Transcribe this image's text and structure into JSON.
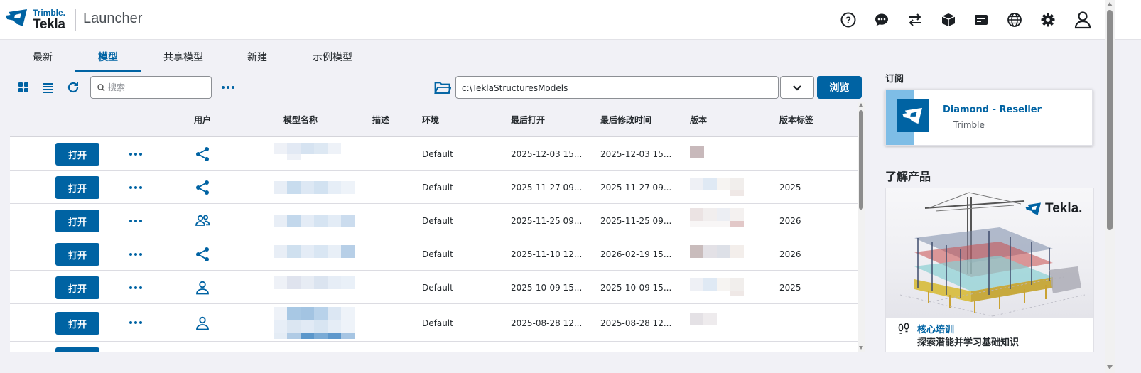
{
  "header": {
    "brand_top": "Trimble.",
    "brand_bottom": "Tekla",
    "app_title": "Launcher",
    "icons": [
      "help-icon",
      "chat-icon",
      "switch-icon",
      "package-icon",
      "license-icon",
      "language-icon",
      "settings-icon",
      "account-icon"
    ]
  },
  "tabs": [
    {
      "label": "最新"
    },
    {
      "label": "模型",
      "active": true
    },
    {
      "label": "共享模型"
    },
    {
      "label": "新建"
    },
    {
      "label": "示例模型"
    }
  ],
  "toolbar": {
    "search_placeholder": "搜索",
    "path_value": "c:\\TeklaStructuresModels",
    "browse_label": "浏览"
  },
  "table": {
    "columns": [
      "用户",
      "模型名称",
      "描述",
      "环境",
      "最后打开",
      "最后修改时间",
      "版本",
      "版本标签"
    ],
    "open_label": "打开",
    "rows": [
      {
        "user_icon": "share-icon",
        "environment": "Default",
        "last_opened": "2025-12-03 15...",
        "last_modified": "2025-12-03 15...",
        "version_tag": ""
      },
      {
        "user_icon": "share-icon",
        "environment": "Default",
        "last_opened": "2025-11-27 09...",
        "last_modified": "2025-11-27 09...",
        "version_tag": "2025"
      },
      {
        "user_icon": "group-icon",
        "environment": "Default",
        "last_opened": "2025-11-25 09...",
        "last_modified": "2025-11-25 09...",
        "version_tag": "2026"
      },
      {
        "user_icon": "share-icon",
        "environment": "Default",
        "last_opened": "2025-11-10 12...",
        "last_modified": "2026-02-19 15...",
        "version_tag": "2026"
      },
      {
        "user_icon": "person-icon",
        "environment": "Default",
        "last_opened": "2025-10-09 15...",
        "last_modified": "2025-10-09 15...",
        "version_tag": "2025"
      },
      {
        "user_icon": "person-icon",
        "environment": "Default",
        "last_opened": "2025-08-28 12...",
        "last_modified": "2025-08-28 12...",
        "version_tag": ""
      }
    ]
  },
  "side": {
    "subscription_title": "订阅",
    "subscription_name": "Diamond - Reseller",
    "subscription_company": "Trimble",
    "learn_title": "了解产品",
    "product_brand": "Tekla.",
    "course_link": "核心培训",
    "course_desc": "探索潜能并学习基础知识"
  },
  "colors": {
    "accent": "#0063a3",
    "page_background": "#f1f1f6"
  }
}
